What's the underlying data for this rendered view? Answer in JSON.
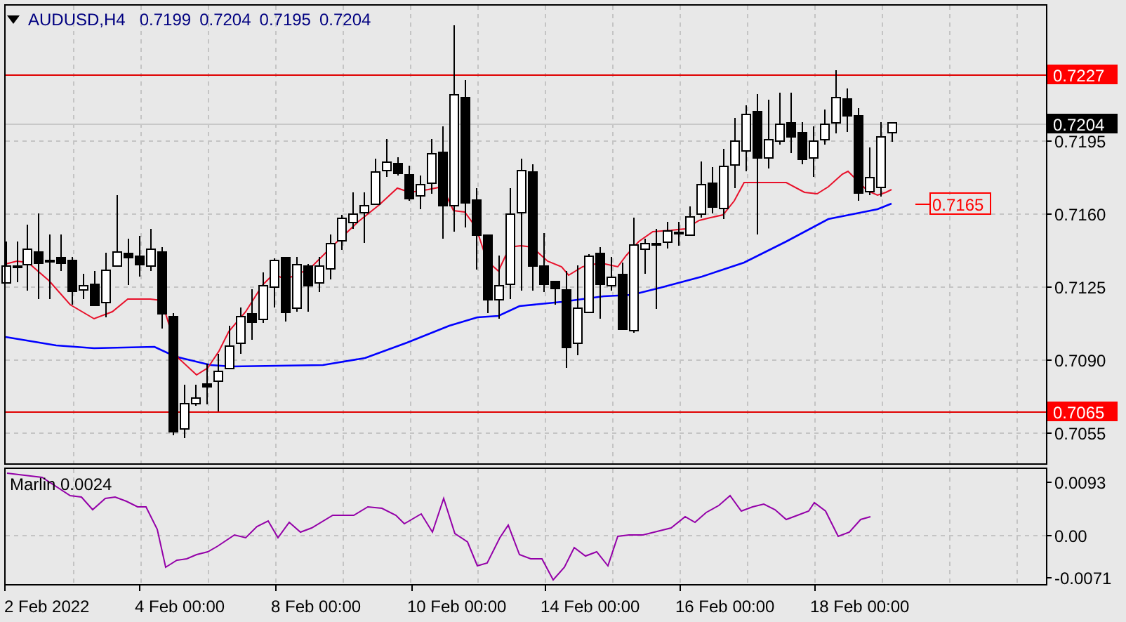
{
  "chart": {
    "symbol": "AUDUSD,H4",
    "ohlc": [
      "0.7199",
      "0.7204",
      "0.7195",
      "0.7204"
    ],
    "price_axis": [
      "0.7195",
      "0.7160",
      "0.7125",
      "0.7090",
      "0.7055"
    ],
    "price_tags": [
      {
        "label": "0.7227",
        "kind": "level"
      },
      {
        "label": "0.7204",
        "kind": "bid"
      },
      {
        "label": "0.7065",
        "kind": "level"
      }
    ],
    "callout": {
      "label": "0.7165"
    },
    "indicator": {
      "name": "Marlin 0.0024",
      "axis": [
        "0.0093",
        "0.00",
        "-0.0071"
      ]
    },
    "time_axis": [
      "2 Feb 2022",
      "4 Feb 00:00",
      "8 Feb 00:00",
      "10 Feb 00:00",
      "14 Feb 00:00",
      "16 Feb 00:00",
      "18 Feb 00:00"
    ]
  }
}
